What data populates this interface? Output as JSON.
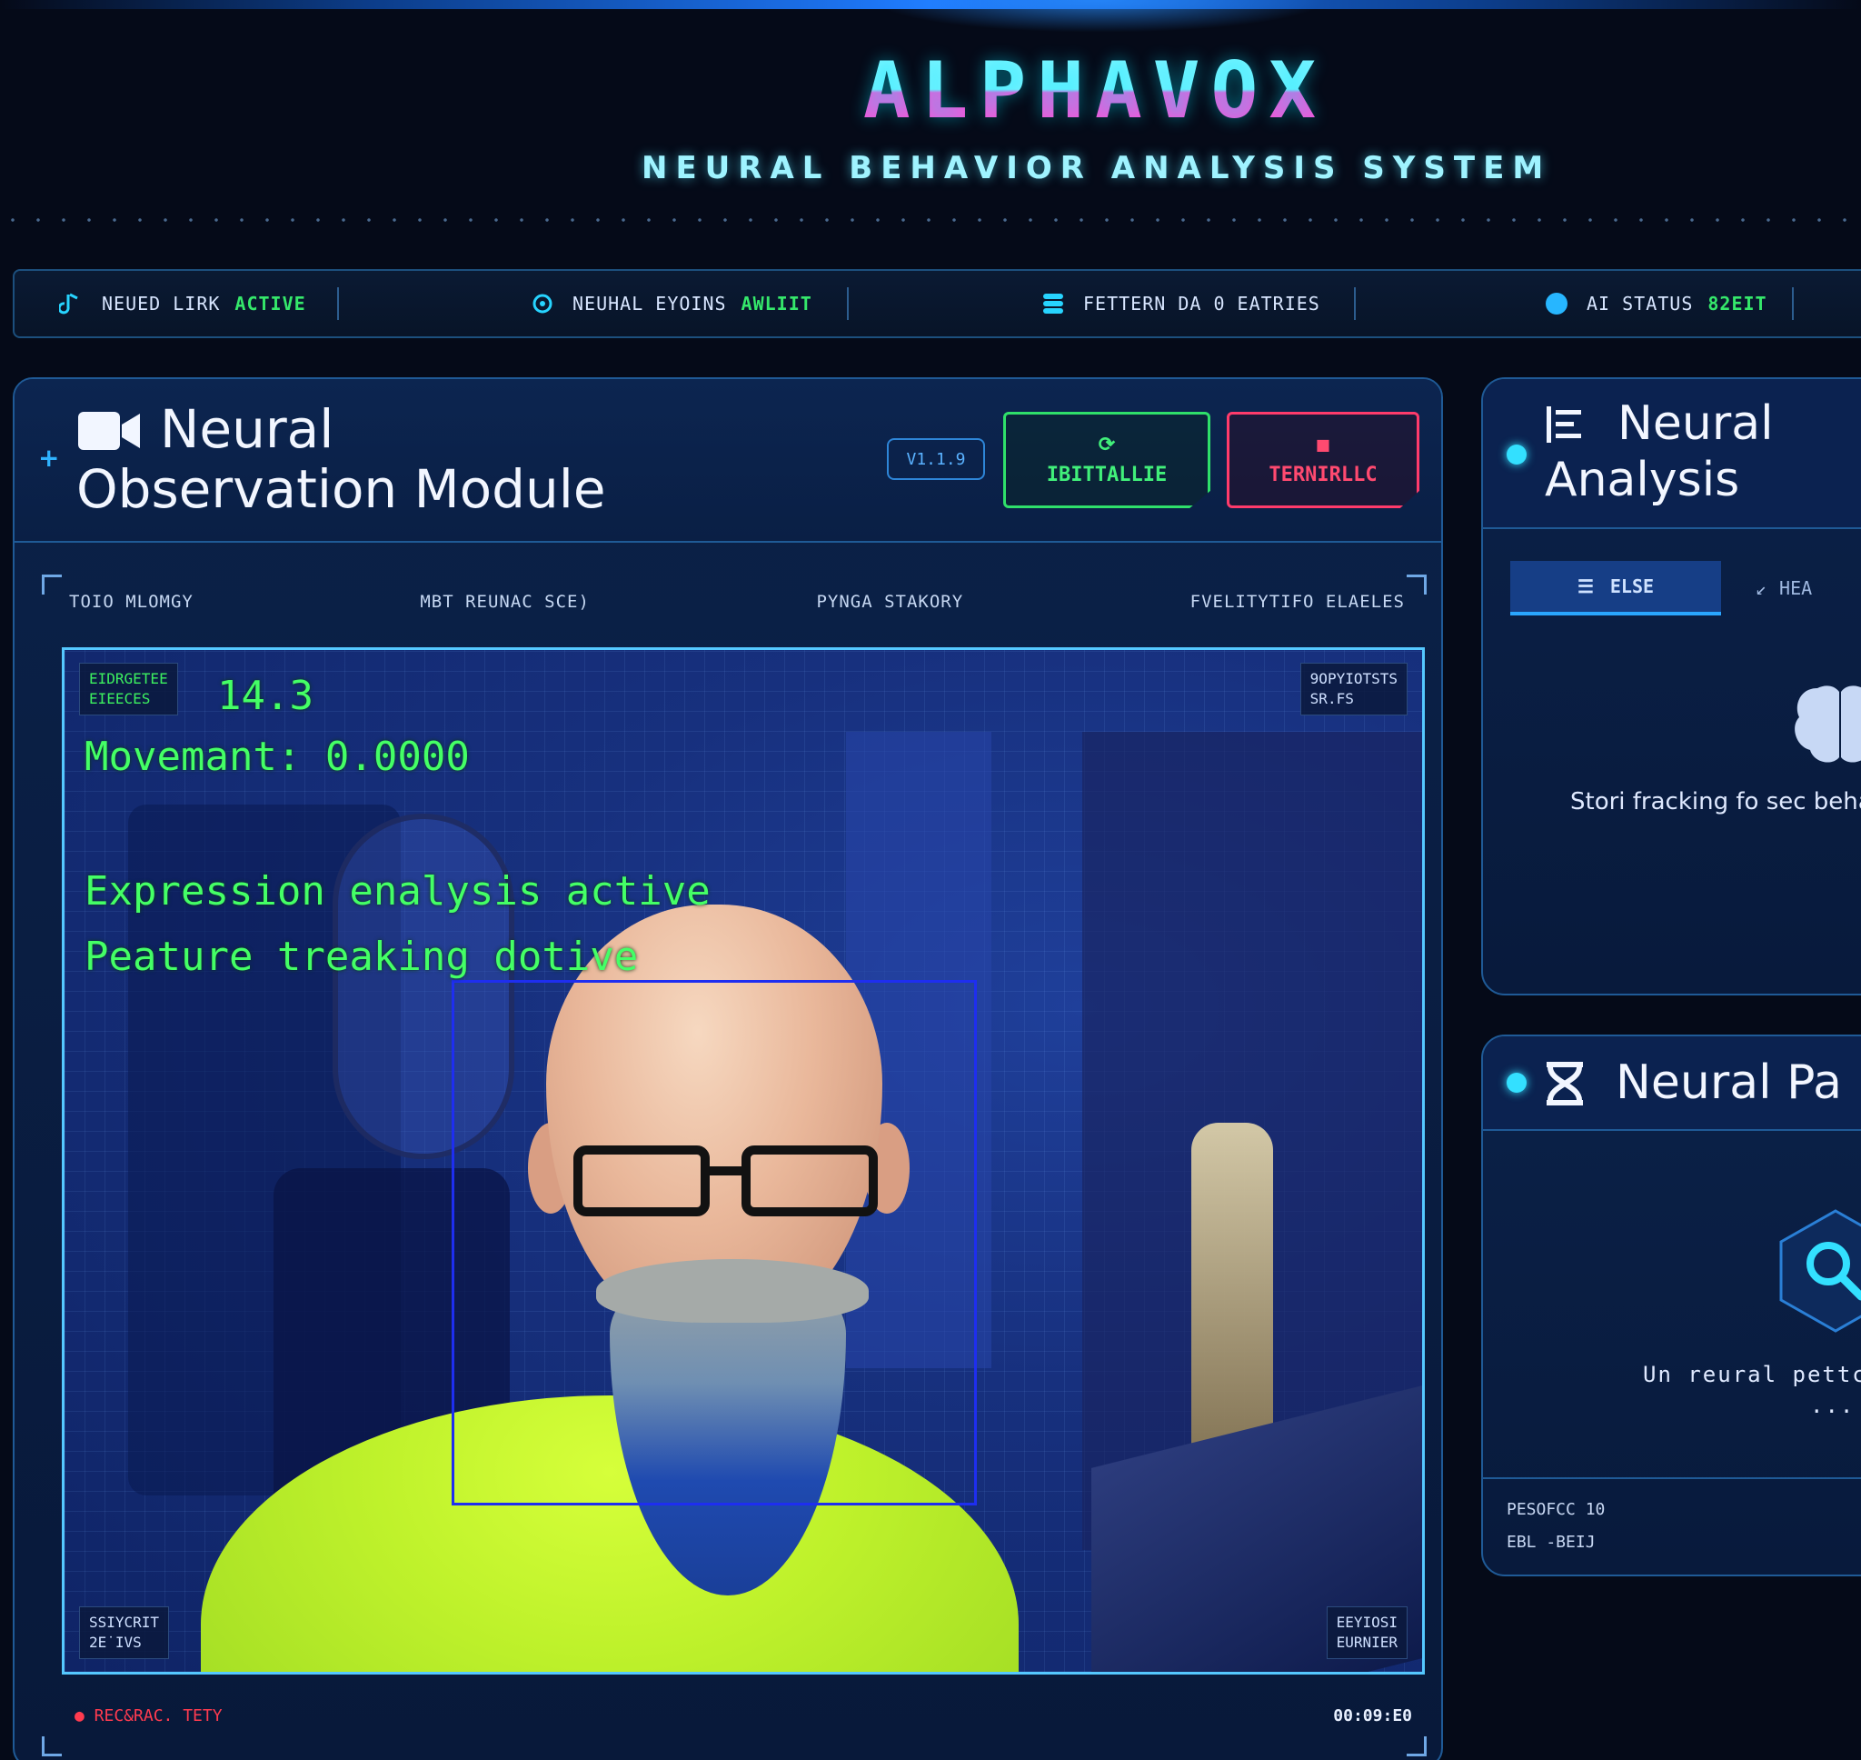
{
  "header": {
    "logo": "ALPHAVOX",
    "subtitle": "NEURAL BEHAVIOR ANALYSIS SYSTEM"
  },
  "status_bar": {
    "items": [
      {
        "icon": "link-icon",
        "label": "NEUED LIRK",
        "value": "ACTIVE"
      },
      {
        "icon": "sync-icon",
        "label": "NEUHAL EYOINS",
        "value": "AWLIIT"
      },
      {
        "icon": "database-icon",
        "label": "FETTERN DA  0  EATRIES",
        "value": ""
      },
      {
        "icon": "status-dot-icon",
        "label": "AI STATUS",
        "value": "82EIT"
      }
    ]
  },
  "observation_module": {
    "title": "Neural Observation Module",
    "version": "V1.1.9",
    "init_button": "IBITTALLIE",
    "terminate_button": "TERNIRLLC",
    "frame_labels": [
      "TOIO MLOMGY",
      "MBT REUNAC SCE)",
      "PYNGA STAKORY",
      "FVELITYTIFO ELAELES"
    ],
    "overlay": {
      "top_left_chip": [
        "EIDRGETEE",
        "EIEECES"
      ],
      "fps_value": "14.3",
      "movement_text": "Movemant: 0.0000",
      "expression_text": "Expression enalysis active",
      "feature_text": "Peature treaking dotive",
      "top_right_chip": [
        "9OPYIOTSTS",
        "SR.FS"
      ],
      "bottom_left_chip": [
        "SSIYCRIT",
        "2E˙IVS"
      ],
      "bottom_right_chip": [
        "EEYIOSI",
        "EURNIER"
      ]
    },
    "footer": {
      "rec_label": "● REC&RAC. TETY",
      "timer": "00:09:E0"
    }
  },
  "neural_analysis": {
    "title": "Neural Analysis",
    "tabs": [
      {
        "label": "ELSE",
        "icon": "list-icon",
        "active": true
      },
      {
        "label": "HEA",
        "icon": "chart-icon",
        "active": false
      }
    ],
    "hint": "Stori fracking fo sec behav"
  },
  "neural_patterns": {
    "title": "Neural Pa",
    "hint": "Un reural pettc",
    "dots": "...",
    "meta": [
      "PESOFCC 10",
      "EBL -BEIJ"
    ]
  },
  "colors": {
    "accent_cyan": "#33e0ff",
    "accent_green": "#35e86b",
    "accent_red": "#ff3b6b",
    "panel_bg": "#0b2148"
  }
}
